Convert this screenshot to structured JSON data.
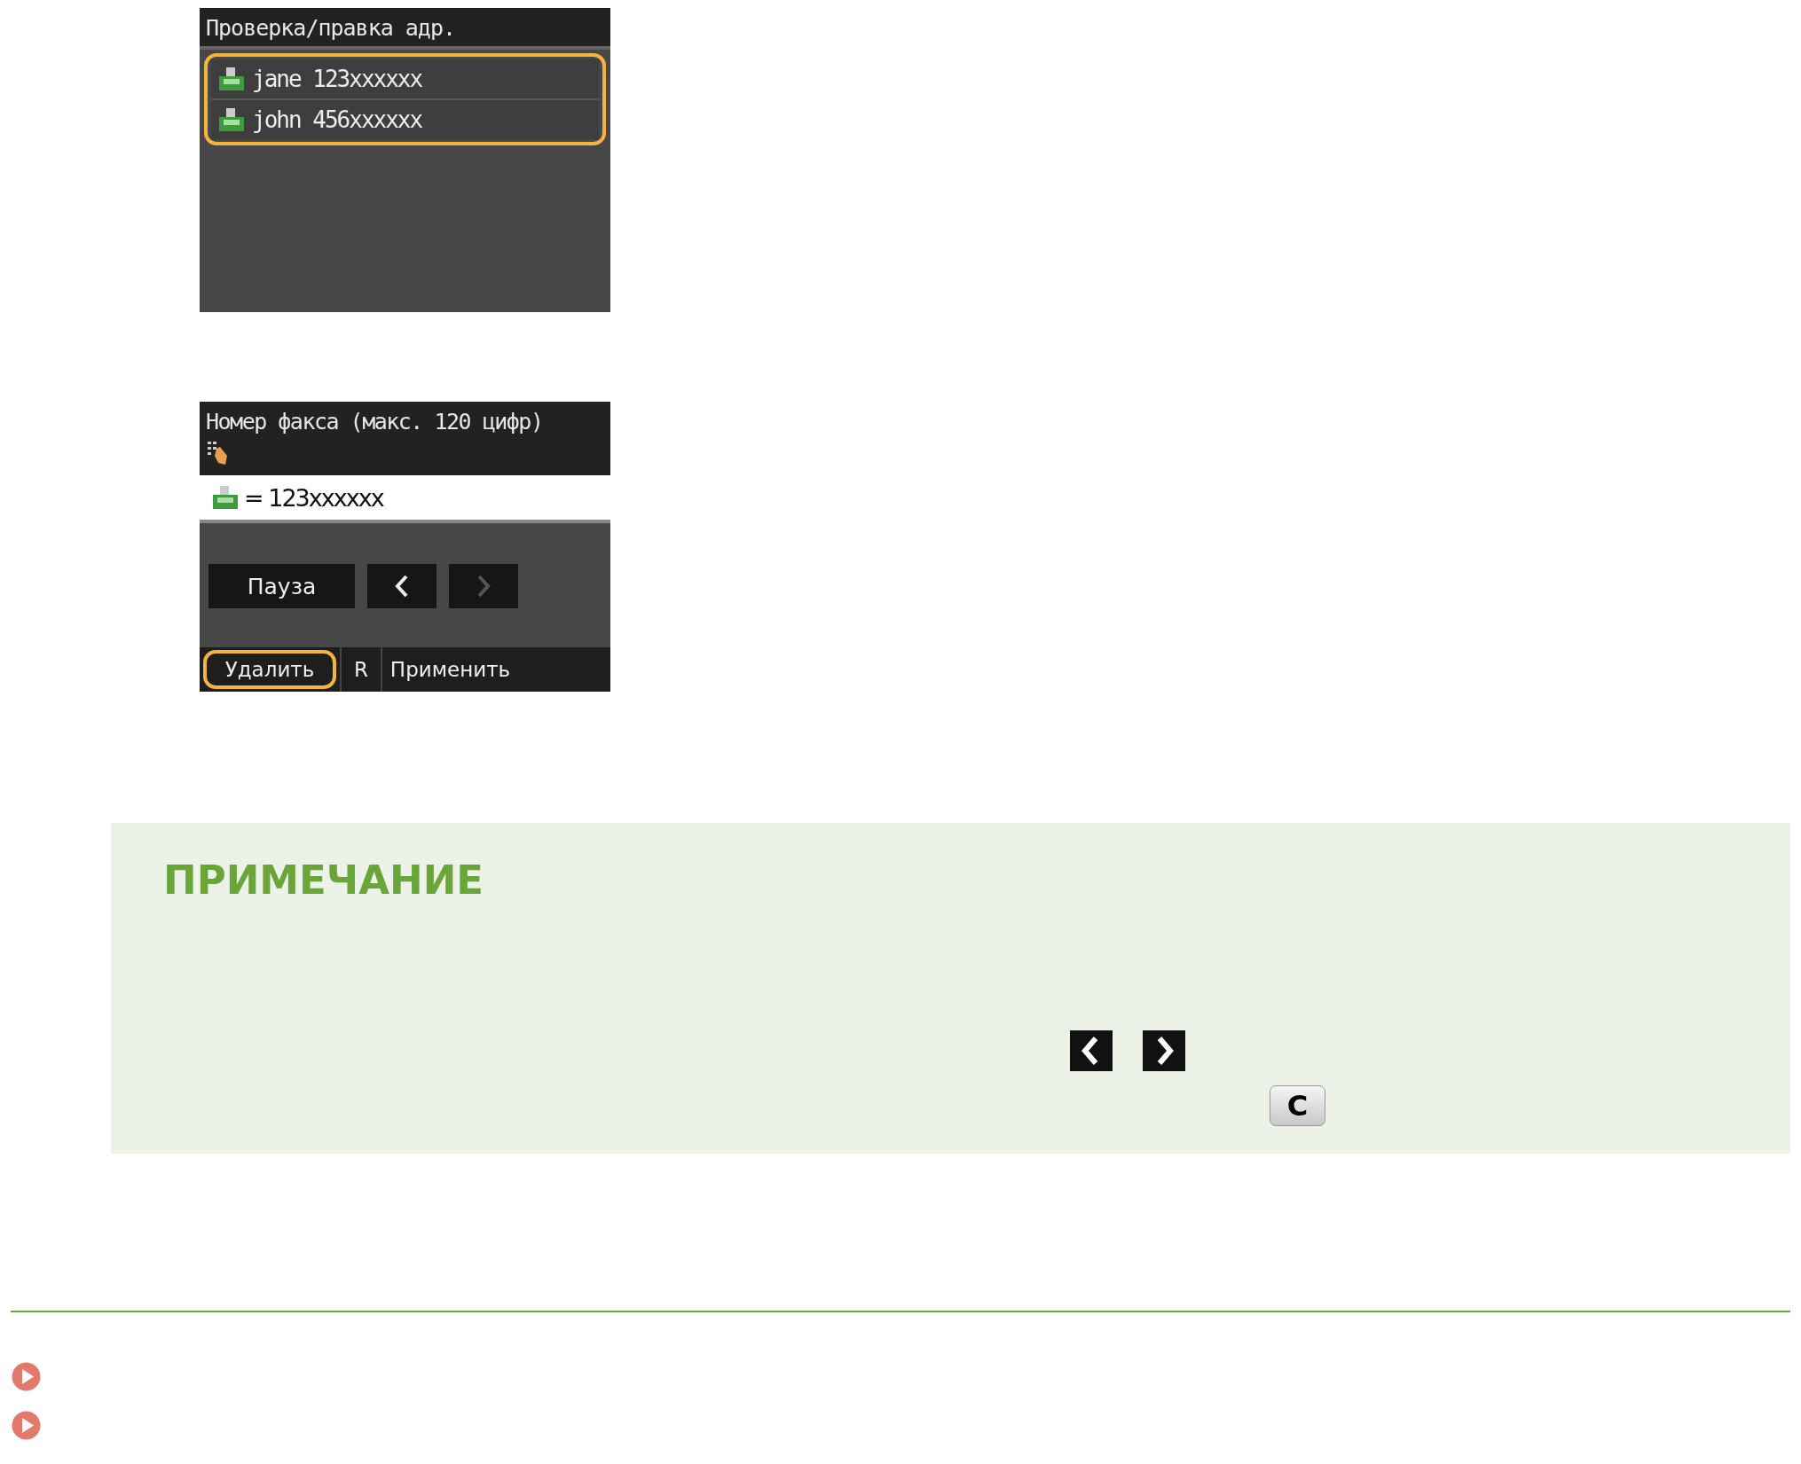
{
  "address_screen": {
    "title": "Проверка/правка адр.",
    "highlighted": true,
    "entries": [
      {
        "text": "jane 123xxxxxx"
      },
      {
        "text": "john 456xxxxxx"
      }
    ]
  },
  "fax_screen": {
    "title": "Номер факса (макс. 120 цифр)",
    "value": "= 123xxxxxx",
    "buttons": [
      {
        "kind": "text",
        "label": "Пауза",
        "disabled": false
      },
      {
        "kind": "left",
        "disabled": false
      },
      {
        "kind": "right",
        "disabled": true
      }
    ],
    "bottom": [
      {
        "label": "Удалить",
        "highlighted": true
      },
      {
        "label": "R",
        "highlighted": false
      },
      {
        "label": "Применить",
        "highlighted": false
      }
    ]
  },
  "note": {
    "title": "ПРИМЕЧАНИЕ",
    "keys": [
      {
        "kind": "left"
      },
      {
        "kind": "right"
      },
      {
        "kind": "clear",
        "label": "C"
      }
    ]
  },
  "links": [
    {
      "kind": "play"
    },
    {
      "kind": "play"
    }
  ]
}
